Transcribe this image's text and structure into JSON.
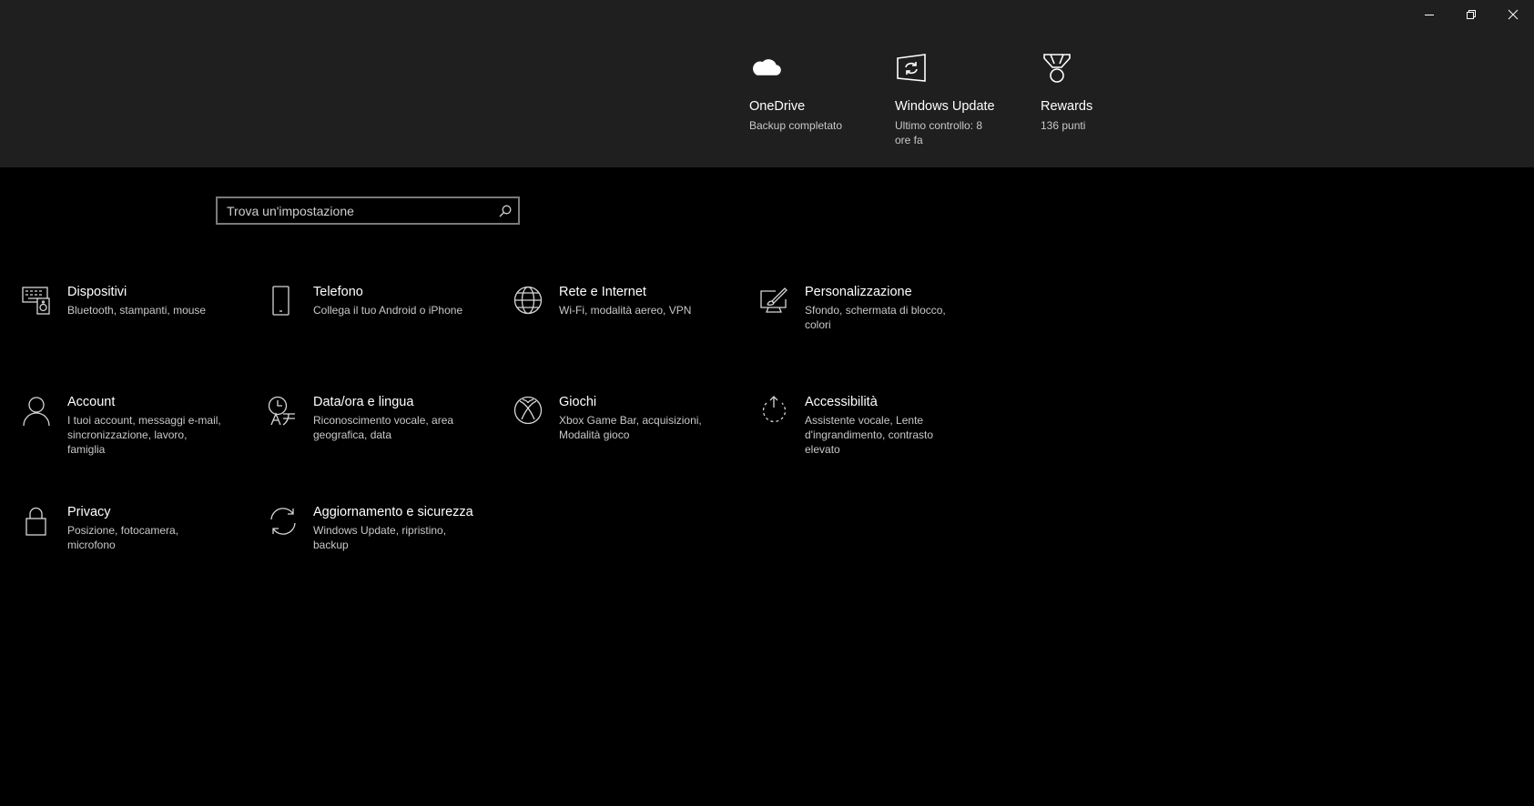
{
  "window": {
    "minimize_label": "Minimize",
    "restore_label": "Restore",
    "close_label": "Close"
  },
  "status": [
    {
      "title": "OneDrive",
      "sub": "Backup completato",
      "icon": "cloud-icon"
    },
    {
      "title": "Windows Update",
      "sub": "Ultimo controllo: 8 ore fa",
      "icon": "windows-update-icon"
    },
    {
      "title": "Rewards",
      "sub": "136 punti",
      "icon": "medal-icon"
    }
  ],
  "search": {
    "placeholder": "Trova un'impostazione",
    "icon": "search-icon"
  },
  "tiles": [
    {
      "title": "Dispositivi",
      "desc": "Bluetooth, stampanti, mouse",
      "icon": "devices-icon"
    },
    {
      "title": "Telefono",
      "desc": "Collega il tuo Android o iPhone",
      "icon": "phone-icon"
    },
    {
      "title": "Rete e Internet",
      "desc": "Wi-Fi, modalità aereo, VPN",
      "icon": "globe-icon"
    },
    {
      "title": "Personalizzazione",
      "desc": "Sfondo, schermata di blocco, colori",
      "icon": "personalization-icon"
    },
    {
      "title": "Account",
      "desc": "I tuoi account, messaggi e-mail, sincronizzazione, lavoro, famiglia",
      "icon": "person-icon"
    },
    {
      "title": "Data/ora e lingua",
      "desc": "Riconoscimento vocale, area geografica, data",
      "icon": "time-language-icon"
    },
    {
      "title": "Giochi",
      "desc": "Xbox Game Bar, acquisizioni, Modalità gioco",
      "icon": "xbox-icon"
    },
    {
      "title": "Accessibilità",
      "desc": "Assistente vocale, Lente d'ingrandimento, contrasto elevato",
      "icon": "accessibility-icon"
    },
    {
      "title": "Privacy",
      "desc": "Posizione, fotocamera, microfono",
      "icon": "lock-icon"
    },
    {
      "title": "Aggiornamento e sicurezza",
      "desc": "Windows Update, ripristino, backup",
      "icon": "sync-icon"
    }
  ]
}
